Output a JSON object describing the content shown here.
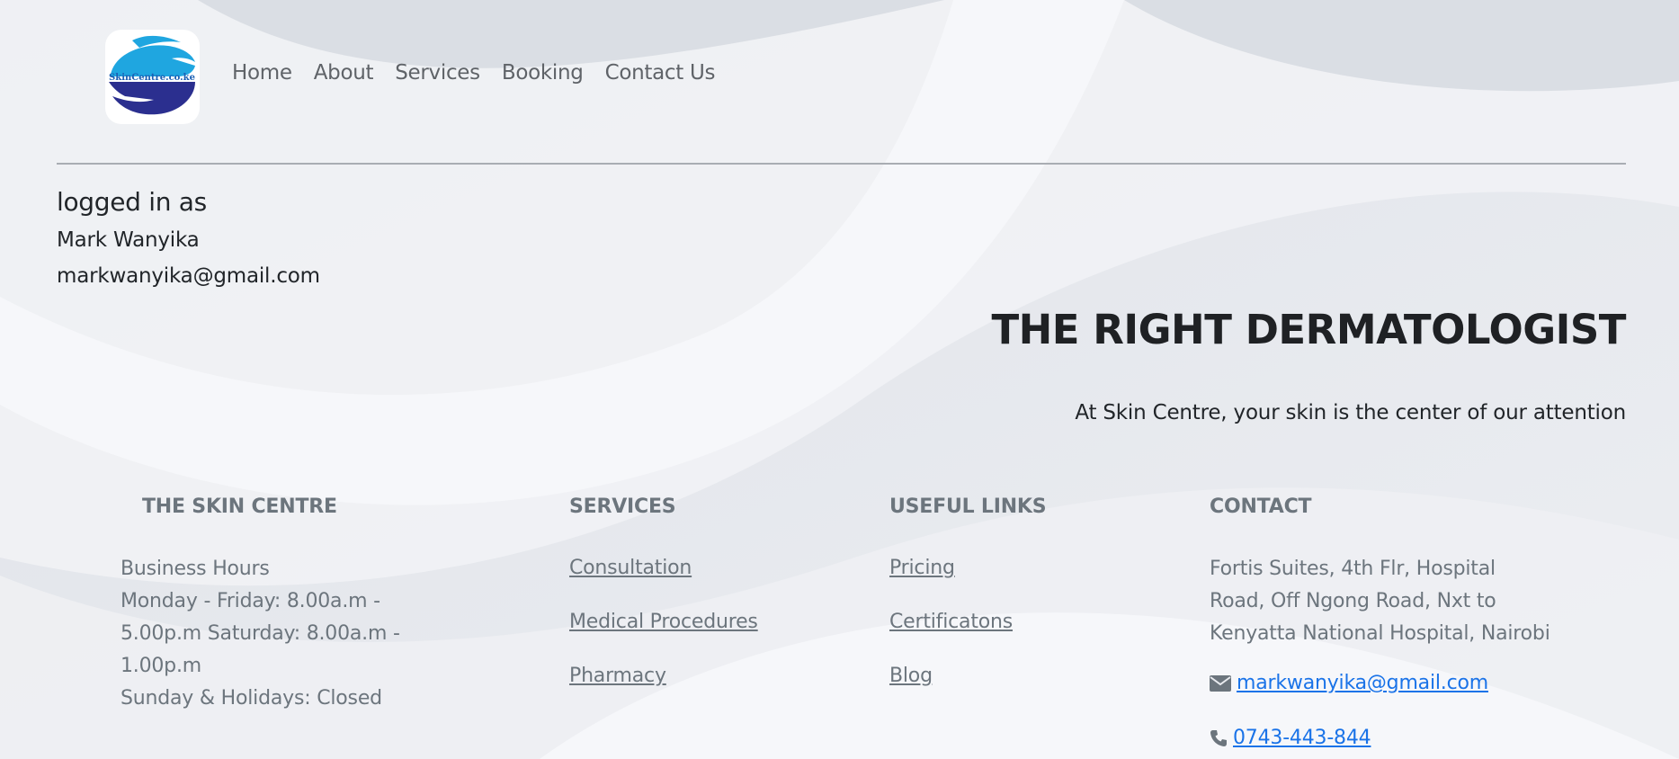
{
  "header": {
    "logo_text": "SkinCentre.co.ke",
    "nav": [
      "Home",
      "About",
      "Services",
      "Booking",
      "Contact Us"
    ]
  },
  "user": {
    "heading": "logged in as",
    "name": "Mark Wanyika",
    "email": "markwanyika@gmail.com"
  },
  "hero": {
    "title": "THE RIGHT DERMATOLOGIST",
    "subtitle": "At Skin Centre, your skin is the center of our attention"
  },
  "footer": {
    "about": {
      "heading": "THE SKIN CENTRE",
      "lines": [
        "Business Hours",
        "Monday - Friday: 8.00a.m -",
        "5.00p.m Saturday: 8.00a.m -",
        "1.00p.m",
        "Sunday & Holidays: Closed"
      ]
    },
    "services": {
      "heading": "SERVICES",
      "links": [
        "Consultation",
        "Medical Procedures",
        "Pharmacy"
      ]
    },
    "useful_links": {
      "heading": "USEFUL LINKS",
      "links": [
        "Pricing",
        "Certificatons",
        "Blog"
      ]
    },
    "contact": {
      "heading": "CONTACT",
      "address_lines": [
        "Fortis Suites, 4th Flr, Hospital",
        "Road, Off Ngong Road, Nxt to",
        "Kenyatta National Hospital, Nairobi"
      ],
      "email": "markwanyika@gmail.com",
      "email_icon": "envelope-icon",
      "phone": "0743-443-844",
      "phone_icon": "phone-icon"
    }
  },
  "colors": {
    "muted_text": "#6c757d",
    "link_blue": "#1a73e8",
    "logo_blue": "#1fa6e0",
    "logo_navy": "#2b2f8f"
  }
}
